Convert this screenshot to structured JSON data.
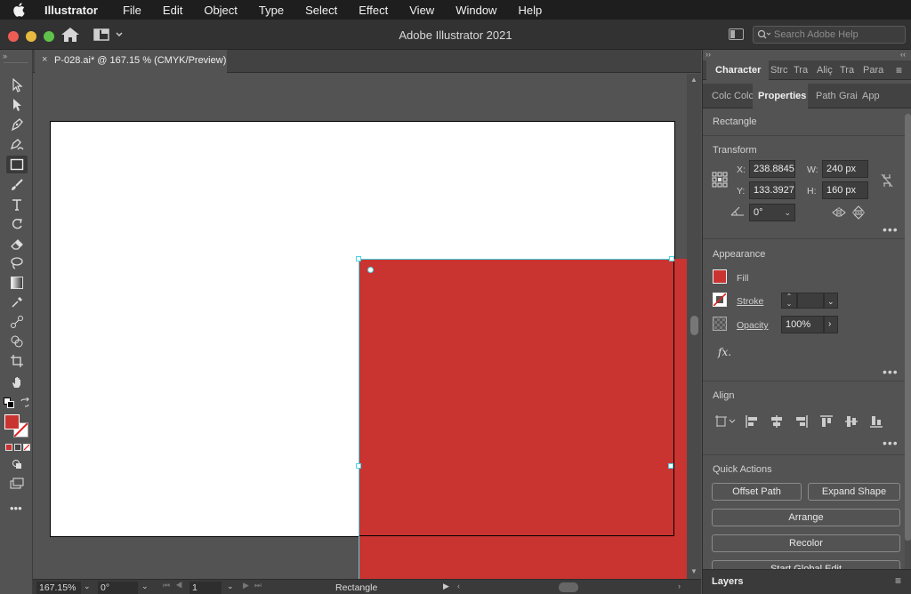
{
  "menubar": {
    "app_name": "Illustrator",
    "items": [
      "File",
      "Edit",
      "Object",
      "Type",
      "Select",
      "Effect",
      "View",
      "Window",
      "Help"
    ]
  },
  "appbar": {
    "title": "Adobe Illustrator 2021",
    "search_placeholder": "Search Adobe Help"
  },
  "document_tab": {
    "label": "P-028.ai* @ 167.15 % (CMYK/Preview)",
    "close": "×"
  },
  "canvas": {
    "fill_color": "#c93431",
    "selection_color": "#4bd5e6"
  },
  "statusbar": {
    "zoom": "167.15%",
    "rotation": "0°",
    "artboard_number": "1",
    "tool_label": "Rectangle"
  },
  "panel": {
    "tabs_row1": [
      "Character",
      "Strc",
      "Tra",
      "Aliç",
      "Tra",
      "Para"
    ],
    "tabs_row2": [
      "Colc",
      "Colc",
      "Properties",
      "Path",
      "Grai",
      "App"
    ],
    "object_type": "Rectangle",
    "transform": {
      "title": "Transform",
      "x_label": "X:",
      "x_value": "238.8845",
      "y_label": "Y:",
      "y_value": "133.3927",
      "w_label": "W:",
      "w_value": "240 px",
      "h_label": "H:",
      "h_value": "160 px",
      "angle_value": "0°"
    },
    "appearance": {
      "title": "Appearance",
      "fill_label": "Fill",
      "stroke_label": "Stroke",
      "opacity_label": "Opacity",
      "opacity_value": "100%",
      "fx_label": "fx."
    },
    "align": {
      "title": "Align"
    },
    "quick_actions": {
      "title": "Quick Actions",
      "offset_path": "Offset Path",
      "expand_shape": "Expand Shape",
      "arrange": "Arrange",
      "recolor": "Recolor",
      "start_global_edit": "Start Global Edit"
    },
    "layers_label": "Layers"
  }
}
